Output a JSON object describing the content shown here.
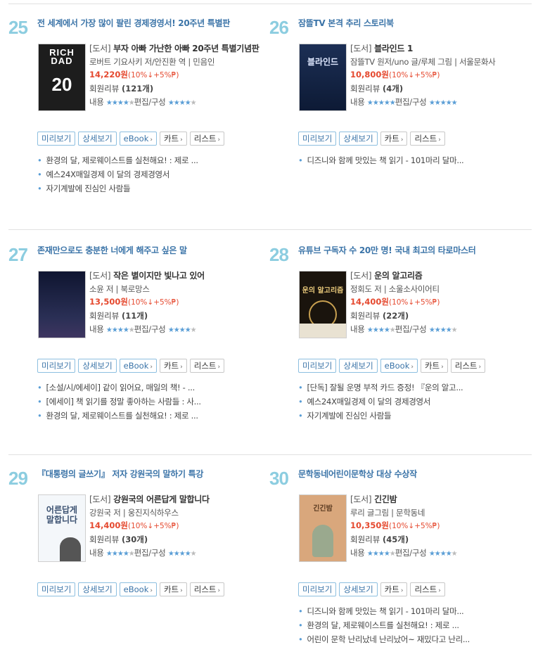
{
  "items": [
    {
      "rank": "25",
      "headline": "전 세계에서 가장 많이 팔린 경제경영서! 20주년 특별판",
      "category": "[도서]",
      "title": "부자 아빠 가난한 아빠 20주년 특별기념판",
      "author": "로버트 기요사키 저/안진환 역 | 민음인",
      "price": "14,220원",
      "discount": "(10%↓+5%₱)",
      "reviews_label": "회원리뷰",
      "reviews_count": "(121개)",
      "rating_text": "내용",
      "rating_sep": "편집/구성",
      "content_stars": 4,
      "edit_stars": 4,
      "cover_text": [
        "RICH",
        "DAD",
        "20"
      ],
      "buttons": [
        "미리보기",
        "상세보기",
        "eBook",
        "카트",
        "리스트"
      ],
      "bullets": [
        "환경의 달, 제로웨이스트를 실천해요! : 제로 ...",
        "예스24X매일경제 이 달의 경제경영서",
        "자기계발에 진심인 사람들"
      ]
    },
    {
      "rank": "26",
      "headline": "잠뜰TV 본격 추리 스토리북",
      "category": "[도서]",
      "title": "블라인드 1",
      "author": "잠뜰TV 원저/uno 글/루체 그림 | 서울문화사",
      "price": "10,800원",
      "discount": "(10%↓+5%₱)",
      "reviews_label": "회원리뷰",
      "reviews_count": "(4개)",
      "rating_text": "내용",
      "rating_sep": "편집/구성",
      "content_stars": 5,
      "edit_stars": 5,
      "cover_text": [
        "블라인드"
      ],
      "buttons": [
        "미리보기",
        "상세보기",
        "카트",
        "리스트"
      ],
      "bullets": [
        "디즈니와 함께 맛있는 책 읽기 - 101마리 달마..."
      ]
    },
    {
      "rank": "27",
      "headline": "존재만으로도 충분한 너에게 해주고 싶은 말",
      "category": "[도서]",
      "title": "작은 별이지만 빛나고 있어",
      "author": "소윤 저 | 북로망스",
      "price": "13,500원",
      "discount": "(10%↓+5%₱)",
      "reviews_label": "회원리뷰",
      "reviews_count": "(11개)",
      "rating_text": "내용",
      "rating_sep": "편집/구성",
      "content_stars": 4,
      "edit_stars": 4,
      "cover_text": [],
      "buttons": [
        "미리보기",
        "상세보기",
        "eBook",
        "카트",
        "리스트"
      ],
      "bullets": [
        "[소설/시/에세이] 같이 읽어요, 매일의 책! - ...",
        "[에세이] 책 읽기를 정말 좋아하는 사람들 : 사...",
        "환경의 달, 제로웨이스트를 실천해요! : 제로 ..."
      ]
    },
    {
      "rank": "28",
      "headline": "유튜브 구독자 수 20만 명! 국내 최고의 타로마스터",
      "category": "[도서]",
      "title": "운의 알고리즘",
      "author": "정회도 저 | 소울소사이어티",
      "price": "14,400원",
      "discount": "(10%↓+5%₱)",
      "reviews_label": "회원리뷰",
      "reviews_count": "(22개)",
      "rating_text": "내용",
      "rating_sep": "편집/구성",
      "content_stars": 4,
      "edit_stars": 4,
      "cover_text": [
        "운의 알고리즘"
      ],
      "buttons": [
        "미리보기",
        "상세보기",
        "eBook",
        "카트",
        "리스트"
      ],
      "bullets": [
        "[단독] 잘될 운명 부적 카드 증정! 『운의 알고...",
        "예스24X매일경제 이 달의 경제경영서",
        "자기계발에 진심인 사람들"
      ]
    },
    {
      "rank": "29",
      "headline": "『대통령의 글쓰기』 저자 강원국의 말하기 특강",
      "category": "[도서]",
      "title": "강원국의 어른답게 말합니다",
      "author": "강원국 저 | 웅진지식하우스",
      "price": "14,400원",
      "discount": "(10%↓+5%₱)",
      "reviews_label": "회원리뷰",
      "reviews_count": "(30개)",
      "rating_text": "내용",
      "rating_sep": "편집/구성",
      "content_stars": 4,
      "edit_stars": 4,
      "cover_text": [
        "어른답게",
        "말합니다"
      ],
      "buttons": [
        "미리보기",
        "상세보기",
        "eBook",
        "카트",
        "리스트"
      ],
      "bullets": []
    },
    {
      "rank": "30",
      "headline": "문학동네어린이문학상 대상 수상작",
      "category": "[도서]",
      "title": "긴긴밤",
      "author": "루리 글그림 | 문학동네",
      "price": "10,350원",
      "discount": "(10%↓+5%₱)",
      "reviews_label": "회원리뷰",
      "reviews_count": "(45개)",
      "rating_text": "내용",
      "rating_sep": "편집/구성",
      "content_stars": 4,
      "edit_stars": 4,
      "cover_text": [
        "긴긴밤"
      ],
      "buttons": [
        "미리보기",
        "상세보기",
        "카트",
        "리스트"
      ],
      "bullets": [
        "디즈니와 함께 맛있는 책 읽기 - 101마리 달마...",
        "환경의 달, 제로웨이스트를 실천해요! : 제로 ...",
        "어린이 문학 난리났네 난리났어~ 재밌다고 난리..."
      ]
    }
  ]
}
